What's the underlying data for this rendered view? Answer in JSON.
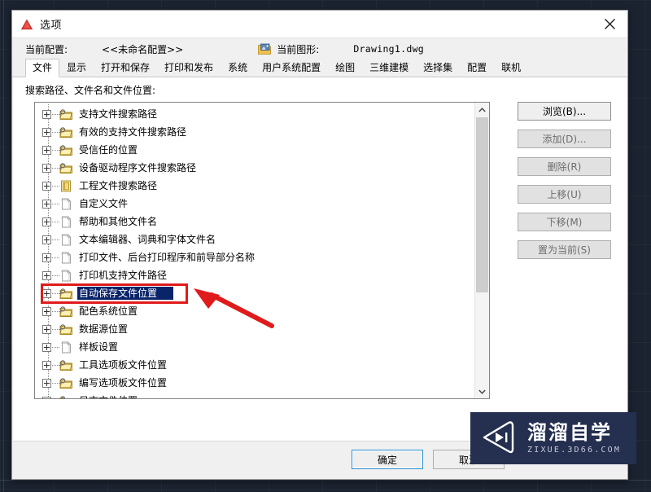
{
  "window": {
    "title": "选项",
    "icon": "autocad-a-icon",
    "close_label": "close-icon"
  },
  "header": {
    "profile_label": "当前配置:",
    "profile_value": "<<未命名配置>>",
    "drawing_label": "当前图形:",
    "drawing_value": "Drawing1.dwg",
    "drawing_icon": "drawing-file-icon"
  },
  "tabs": [
    {
      "label": "文件",
      "active": true
    },
    {
      "label": "显示",
      "active": false
    },
    {
      "label": "打开和保存",
      "active": false
    },
    {
      "label": "打印和发布",
      "active": false
    },
    {
      "label": "系统",
      "active": false
    },
    {
      "label": "用户系统配置",
      "active": false
    },
    {
      "label": "绘图",
      "active": false
    },
    {
      "label": "三维建模",
      "active": false
    },
    {
      "label": "选择集",
      "active": false
    },
    {
      "label": "配置",
      "active": false
    },
    {
      "label": "联机",
      "active": false
    }
  ],
  "main": {
    "section_label": "搜索路径、文件名和文件位置:",
    "tree": [
      {
        "label": "支持文件搜索路径",
        "icon": "folder-search-icon",
        "selected": false
      },
      {
        "label": "有效的支持文件搜索路径",
        "icon": "folder-search-icon",
        "selected": false
      },
      {
        "label": "受信任的位置",
        "icon": "folder-search-icon",
        "selected": false
      },
      {
        "label": "设备驱动程序文件搜索路径",
        "icon": "folder-search-icon",
        "selected": false
      },
      {
        "label": "工程文件搜索路径",
        "icon": "project-file-icon",
        "selected": false
      },
      {
        "label": "自定义文件",
        "icon": "file-icon",
        "selected": false
      },
      {
        "label": "帮助和其他文件名",
        "icon": "file-icon",
        "selected": false
      },
      {
        "label": "文本编辑器、词典和字体文件名",
        "icon": "file-icon",
        "selected": false
      },
      {
        "label": "打印文件、后台打印程序和前导部分名称",
        "icon": "file-icon",
        "selected": false
      },
      {
        "label": "打印机支持文件路径",
        "icon": "file-icon",
        "selected": false
      },
      {
        "label": "自动保存文件位置",
        "icon": "folder-search-icon",
        "selected": true
      },
      {
        "label": "配色系统位置",
        "icon": "folder-search-icon",
        "selected": false
      },
      {
        "label": "数据源位置",
        "icon": "folder-search-icon",
        "selected": false
      },
      {
        "label": "样板设置",
        "icon": "file-icon",
        "selected": false
      },
      {
        "label": "工具选项板文件位置",
        "icon": "folder-search-icon",
        "selected": false
      },
      {
        "label": "编写选项板文件位置",
        "icon": "folder-search-icon",
        "selected": false
      },
      {
        "label": "日志文件位置",
        "icon": "folder-search-icon",
        "selected": false
      }
    ],
    "side_buttons": [
      {
        "label": "浏览(B)...",
        "enabled": true
      },
      {
        "label": "添加(D)...",
        "enabled": false
      },
      {
        "label": "删除(R)",
        "enabled": false
      },
      {
        "label": "上移(U)",
        "enabled": false
      },
      {
        "label": "下移(M)",
        "enabled": false
      },
      {
        "label": "置为当前(S)",
        "enabled": false
      }
    ]
  },
  "footer": {
    "ok_label": "确定",
    "cancel_label": "取消"
  },
  "watermark": {
    "cn": "溜溜自学",
    "en": "ZIXUE.3D66.COM",
    "bg": "#253050"
  },
  "annotation": {
    "highlight_color": "#e01b1b",
    "target_item": "自动保存文件位置"
  }
}
